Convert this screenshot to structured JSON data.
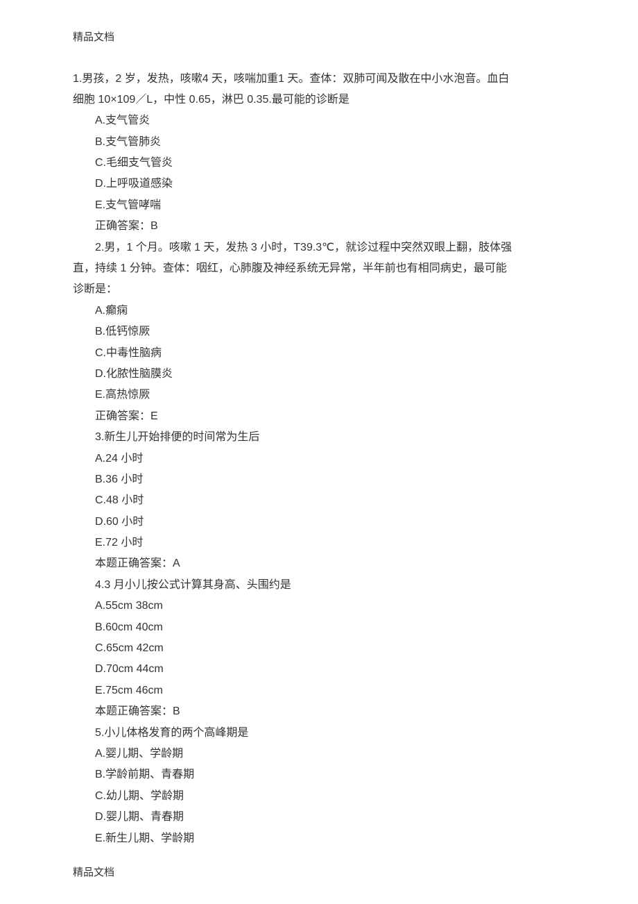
{
  "header": "精品文档",
  "footer": "精品文档",
  "questions": [
    {
      "stem_lines": [
        "1.男孩，2 岁，发热，咳嗽4 天，咳喘加重1 天。查体：双肺可闻及散在中小水泡音。血白",
        "细胞 10×109／L，中性 0.65，淋巴 0.35.最可能的诊断是"
      ],
      "options": [
        "A.支气管炎",
        "B.支气管肺炎",
        "C.毛细支气管炎",
        "D.上呼吸道感染",
        "E.支气管哮喘"
      ],
      "answer": "正确答案：B"
    },
    {
      "stem_lines_indented": [
        "2.男，1 个月。咳嗽 1 天，发热 3 小时，T39.3℃，就诊过程中突然双眼上翻，肢体强"
      ],
      "stem_lines_noindent": [
        "直，持续 1 分钟。查体：咽红，心肺腹及神经系统无异常，半年前也有相同病史，最可能",
        "诊断是："
      ],
      "options": [
        "A.癫痫",
        "B.低钙惊厥",
        "C.中毒性脑病",
        "D.化脓性脑膜炎",
        "E.高热惊厥"
      ],
      "answer": "正确答案：E"
    },
    {
      "stem_lines_indented": [
        "3.新生儿开始排便的时间常为生后"
      ],
      "options": [
        "A.24 小时",
        "B.36 小时",
        "C.48 小时",
        "D.60 小时",
        "E.72 小时"
      ],
      "answer": "本题正确答案：A"
    },
    {
      "stem_lines_indented": [
        "4.3 月小儿按公式计算其身高、头围约是"
      ],
      "options": [
        "A.55cm 38cm",
        "B.60cm 40cm",
        "C.65cm 42cm",
        "D.70cm 44cm",
        "E.75cm 46cm"
      ],
      "answer": "本题正确答案：B"
    },
    {
      "stem_lines_indented": [
        "5.小儿体格发育的两个高峰期是"
      ],
      "options": [
        "A.婴儿期、学龄期",
        "B.学龄前期、青春期",
        "C.幼儿期、学龄期",
        "D.婴儿期、青春期",
        "E.新生儿期、学龄期"
      ]
    }
  ]
}
